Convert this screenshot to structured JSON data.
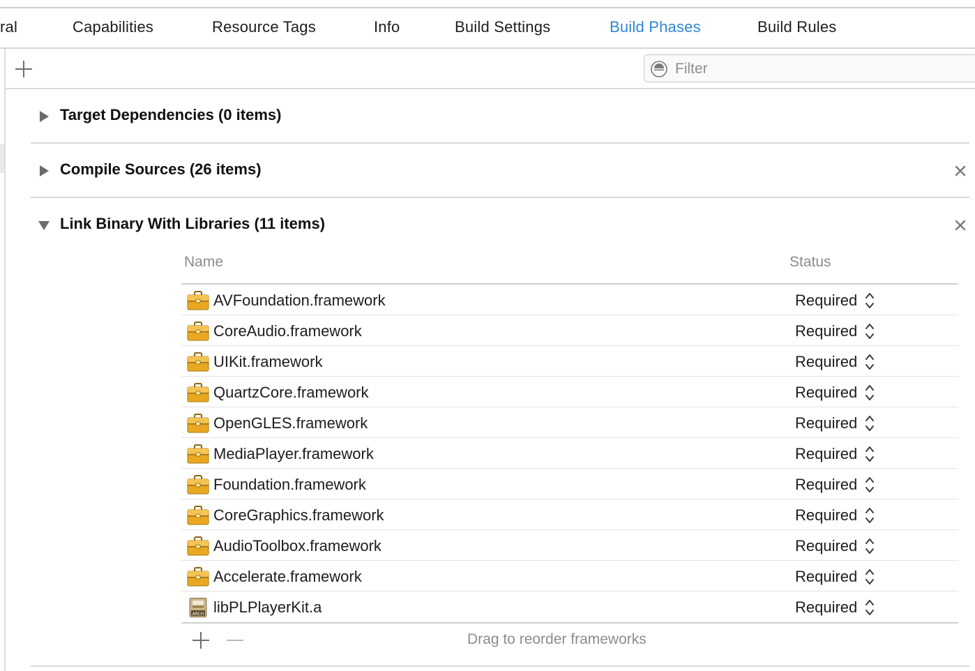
{
  "tabs": [
    {
      "label": "ral",
      "active": false
    },
    {
      "label": "Capabilities",
      "active": false
    },
    {
      "label": "Resource Tags",
      "active": false
    },
    {
      "label": "Info",
      "active": false
    },
    {
      "label": "Build Settings",
      "active": false
    },
    {
      "label": "Build Phases",
      "active": true
    },
    {
      "label": "Build Rules",
      "active": false
    }
  ],
  "toolbar": {
    "add_icon": "plus-icon",
    "filter_placeholder": "Filter",
    "filter_icon": "filter-icon"
  },
  "sections": {
    "target_dependencies": {
      "title": "Target Dependencies (0 items)",
      "expanded": false
    },
    "compile_sources": {
      "title": "Compile Sources (26 items)",
      "expanded": false
    },
    "link_binary": {
      "title": "Link Binary With Libraries (11 items)",
      "expanded": true
    }
  },
  "table": {
    "columns": {
      "name": "Name",
      "status": "Status"
    },
    "rows": [
      {
        "name": "AVFoundation.framework",
        "status": "Required",
        "icon": "framework-toolbox-icon"
      },
      {
        "name": "CoreAudio.framework",
        "status": "Required",
        "icon": "framework-toolbox-icon"
      },
      {
        "name": "UIKit.framework",
        "status": "Required",
        "icon": "framework-toolbox-icon"
      },
      {
        "name": "QuartzCore.framework",
        "status": "Required",
        "icon": "framework-toolbox-icon"
      },
      {
        "name": "OpenGLES.framework",
        "status": "Required",
        "icon": "framework-toolbox-icon"
      },
      {
        "name": "MediaPlayer.framework",
        "status": "Required",
        "icon": "framework-toolbox-icon"
      },
      {
        "name": "Foundation.framework",
        "status": "Required",
        "icon": "framework-toolbox-icon"
      },
      {
        "name": "CoreGraphics.framework",
        "status": "Required",
        "icon": "framework-toolbox-icon"
      },
      {
        "name": "AudioToolbox.framework",
        "status": "Required",
        "icon": "framework-toolbox-icon"
      },
      {
        "name": "Accelerate.framework",
        "status": "Required",
        "icon": "framework-toolbox-icon"
      },
      {
        "name": "libPLPlayerKit.a",
        "status": "Required",
        "icon": "static-library-icon",
        "icon_label": "ARCH"
      }
    ],
    "footer_hint": "Drag to reorder frameworks"
  },
  "colors": {
    "accent": "#2f86d6",
    "toolbox": "#e9a820"
  }
}
